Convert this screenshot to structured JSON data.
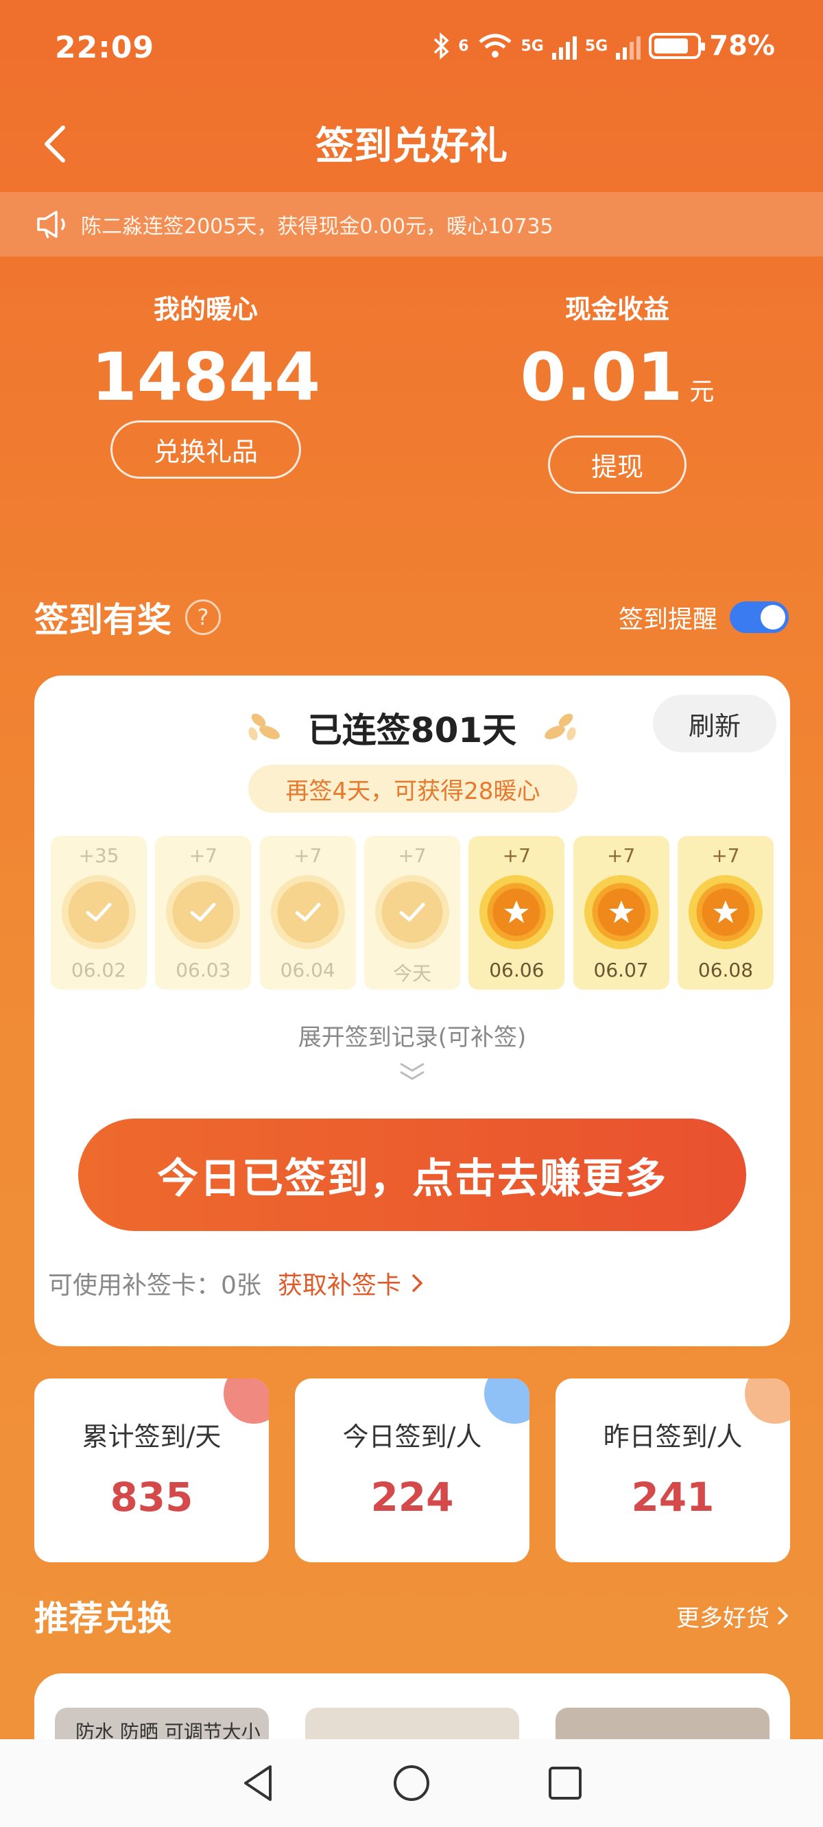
{
  "status_bar": {
    "time": "22:09",
    "battery": "78%",
    "battery_level": 0.78,
    "net1": "5G",
    "net2": "5G",
    "wifi_badge": "6"
  },
  "header": {
    "title": "签到兑好礼"
  },
  "notice": {
    "text": "陈二淼连签2005天，获得现金0.00元，暖心10735"
  },
  "summary": {
    "left_label": "我的暖心",
    "left_value": "14844",
    "left_button": "兑换礼品",
    "right_label": "现金收益",
    "right_value": "0.01",
    "right_unit": "元",
    "right_button": "提现"
  },
  "section": {
    "title": "签到有奖",
    "help": "?",
    "reminder_label": "签到提醒",
    "reminder_on": true
  },
  "checkin": {
    "streak_text": "已连签801天",
    "refresh": "刷新",
    "hint": "再签4天，可获得28暖心",
    "days": [
      {
        "pts": "+35",
        "date": "06.02",
        "done": true
      },
      {
        "pts": "+7",
        "date": "06.03",
        "done": true
      },
      {
        "pts": "+7",
        "date": "06.04",
        "done": true
      },
      {
        "pts": "+7",
        "date": "今天",
        "done": true
      },
      {
        "pts": "+7",
        "date": "06.06",
        "done": false
      },
      {
        "pts": "+7",
        "date": "06.07",
        "done": false
      },
      {
        "pts": "+7",
        "date": "06.08",
        "done": false
      }
    ],
    "expand_text": "展开签到记录(可补签)",
    "main_button": "今日已签到，点击去赚更多",
    "card_label": "可使用补签卡：0张",
    "card_link": "获取补签卡"
  },
  "stats": [
    {
      "label": "累计签到/天",
      "value": "835",
      "dot_color": "#f08a80"
    },
    {
      "label": "今日签到/人",
      "value": "224",
      "dot_color": "#8fc1f7"
    },
    {
      "label": "昨日签到/人",
      "value": "241",
      "dot_color": "#f6b98c"
    }
  ],
  "recommend": {
    "title": "推荐兑换",
    "more": "更多好货",
    "thumb_text": "防水 防晒 可调节大小"
  },
  "colors": {
    "accent": "#ef6f2c",
    "button": "#e9512f",
    "toggle": "#3b7bf2",
    "stat_value": "#d44a4a"
  }
}
